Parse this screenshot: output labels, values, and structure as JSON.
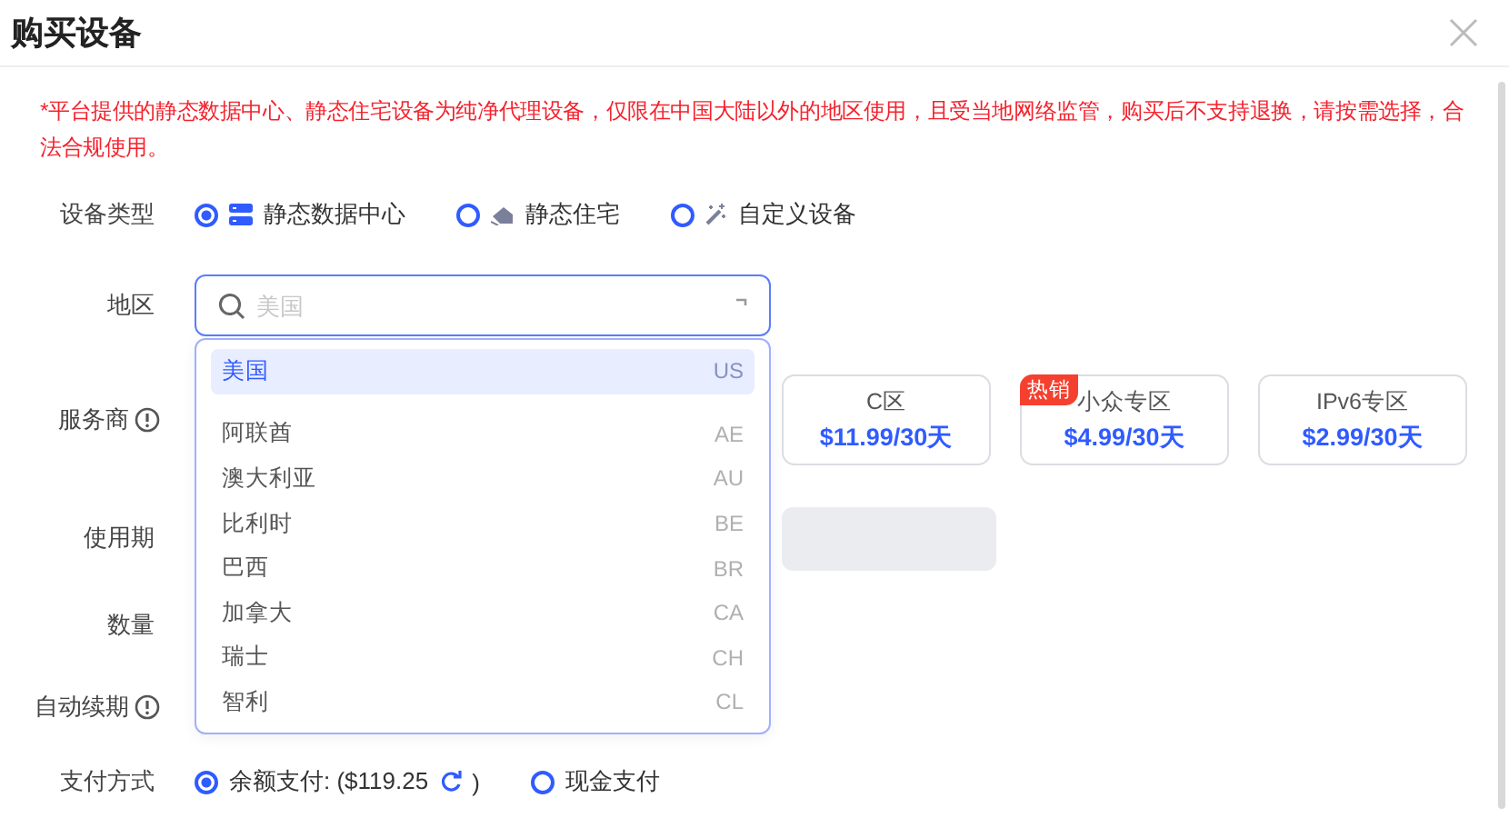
{
  "dialog": {
    "title": "购买设备",
    "notice": "*平台提供的静态数据中心、静态住宅设备为纯净代理设备，仅限在中国大陆以外的地区使用，且受当地网络监管，购买后不支持退换，请按需选择，合法合规使用。"
  },
  "device_type": {
    "label": "设备类型",
    "options": [
      {
        "label": "静态数据中心",
        "kind": "datacenter",
        "selected": true
      },
      {
        "label": "静态住宅",
        "kind": "residential",
        "selected": false
      },
      {
        "label": "自定义设备",
        "kind": "custom",
        "selected": false
      }
    ]
  },
  "region": {
    "label": "地区",
    "placeholder": "美国",
    "options": [
      {
        "name": "美国",
        "code": "US",
        "selected": true
      },
      {
        "name": "阿联酋",
        "code": "AE",
        "selected": false
      },
      {
        "name": "澳大利亚",
        "code": "AU",
        "selected": false
      },
      {
        "name": "比利时",
        "code": "BE",
        "selected": false
      },
      {
        "name": "巴西",
        "code": "BR",
        "selected": false
      },
      {
        "name": "加拿大",
        "code": "CA",
        "selected": false
      },
      {
        "name": "瑞士",
        "code": "CH",
        "selected": false
      },
      {
        "name": "智利",
        "code": "CL",
        "selected": false
      }
    ]
  },
  "provider": {
    "label": "服务商",
    "plans": [
      {
        "name": "C区",
        "price": "$11.99/30天"
      },
      {
        "name": "小众专区",
        "price": "$4.99/30天",
        "badge": "热销"
      },
      {
        "name": "IPv6专区",
        "price": "$2.99/30天"
      }
    ]
  },
  "period": {
    "label": "使用期"
  },
  "quantity": {
    "label": "数量"
  },
  "auto_renew": {
    "label": "自动续期"
  },
  "payment": {
    "label": "支付方式",
    "options": [
      {
        "label": "余额支付: ($119.25",
        "suffix": ")",
        "kind": "balance",
        "selected": true
      },
      {
        "label": "现金支付",
        "kind": "cash",
        "selected": false
      }
    ]
  }
}
